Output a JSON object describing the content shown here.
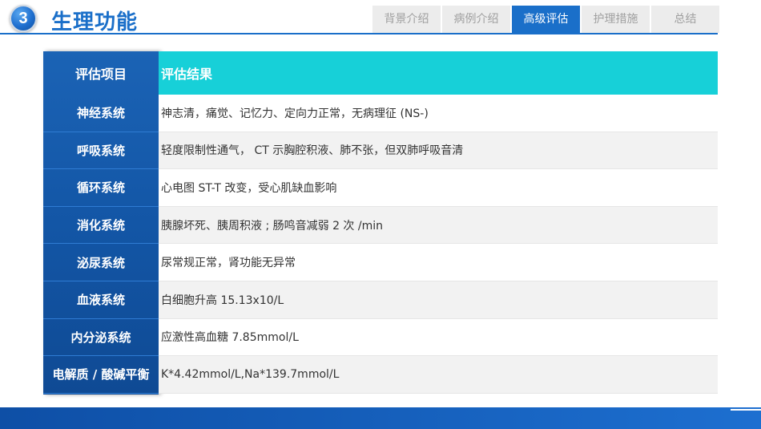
{
  "header": {
    "section_number": "3",
    "section_title": "生理功能",
    "tabs": [
      {
        "label": "背景介绍",
        "active": false
      },
      {
        "label": "病例介绍",
        "active": false
      },
      {
        "label": "高级评估",
        "active": true
      },
      {
        "label": "护理措施",
        "active": false
      },
      {
        "label": "总结",
        "active": false
      }
    ]
  },
  "table": {
    "header": {
      "item": "评估项目",
      "result": "评估结果"
    },
    "rows": [
      {
        "item": "神经系统",
        "result": "神志清，痛觉、记忆力、定向力正常，无病理征 (NS-)"
      },
      {
        "item": "呼吸系统",
        "result": "轻度限制性通气， CT 示胸腔积液、肺不张，但双肺呼吸音清"
      },
      {
        "item": "循环系统",
        "result": "心电图 ST-T 改变，受心肌缺血影响"
      },
      {
        "item": "消化系统",
        "result": "胰腺坏死、胰周积液 ; 肠鸣音减弱 2 次 /min"
      },
      {
        "item": "泌尿系统",
        "result": "尿常规正常，肾功能无异常"
      },
      {
        "item": "血液系统",
        "result": "白细胞升高 15.13x10/L"
      },
      {
        "item": "内分泌系统",
        "result": "应激性高血糖 7.85mmol/L"
      },
      {
        "item": "电解质 / 酸碱平衡",
        "result": "K*4.42mmol/L,Na*139.7mmol/L"
      }
    ]
  },
  "colors": {
    "accent": "#1a6fc9",
    "table_header": "#17d0d8",
    "label_column": "#1356a6"
  }
}
